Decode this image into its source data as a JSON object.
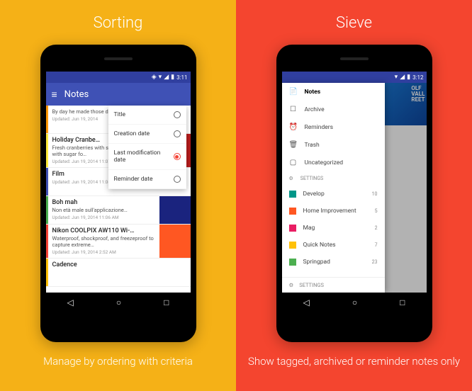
{
  "left": {
    "title": "Sorting",
    "caption": "Manage by ordering with criteria",
    "status_time": "3:11",
    "appbar_title": "Notes",
    "sort_options": [
      {
        "label": "Title",
        "selected": false
      },
      {
        "label": "Creation date",
        "selected": false
      },
      {
        "label": "Last modification date",
        "selected": true
      },
      {
        "label": "Reminder date",
        "selected": false
      }
    ],
    "notes": [
      {
        "stripe": "#ff9800",
        "title": "",
        "excerpt": "By day he made those dollars a minute. B…",
        "updated": "Updated: Jun 19, 2014",
        "thumb": false
      },
      {
        "stripe": "#ffeb3b",
        "title": "Holiday Cranbe…",
        "excerpt": "Fresh cranberries with spices and cooked with sugar fo…",
        "updated": "Updated: Jun 19, 2014 11:07 AM",
        "thumb": true,
        "thumb_bg": "#b71c1c"
      },
      {
        "stripe": "#3f51b5",
        "title": "Film",
        "excerpt": "",
        "updated": "Updated: Jun 19, 2014 11:06 AM",
        "thumb": false
      },
      {
        "stripe": "#4caf50",
        "title": "Boh mah",
        "excerpt": "Non età male sull'applicazione…",
        "updated": "Updated: Jun 19, 2014 11:06 AM",
        "thumb": true,
        "thumb_bg": "#1a237e"
      },
      {
        "stripe": "#f44336",
        "title": "Nikon COOLPIX AW110 Wi-…",
        "excerpt": "Waterproof, shockproof, and freezeproof to capture extreme…",
        "updated": "Updated: Jun 19, 2014 2:52 AM",
        "thumb": true,
        "thumb_bg": "#ff5722"
      },
      {
        "stripe": "#ffc107",
        "title": "Cadence",
        "excerpt": "",
        "updated": "",
        "thumb": false
      }
    ]
  },
  "right": {
    "title": "Sieve",
    "caption": "Show tagged, archived or reminder notes only",
    "status_time": "3:12",
    "bg_text": "OLF\nVALL\nREET",
    "drawer": {
      "main": [
        {
          "icon": "📄",
          "label": "Notes",
          "bold": true
        },
        {
          "icon": "☐",
          "label": "Archive"
        },
        {
          "icon": "⏰",
          "label": "Reminders"
        },
        {
          "icon": "🗑",
          "label": "Trash"
        },
        {
          "icon": "▢",
          "label": "Uncategorized"
        }
      ],
      "settings_header": "SETTINGS",
      "tags": [
        {
          "color": "#009688",
          "label": "Develop",
          "count": "10"
        },
        {
          "color": "#ff5722",
          "label": "Home Improvement",
          "count": "5"
        },
        {
          "color": "#e91e63",
          "label": "Mag",
          "count": "2"
        },
        {
          "color": "#ffc107",
          "label": "Quick Notes",
          "count": "7"
        },
        {
          "color": "#4caf50",
          "label": "Springpad",
          "count": "23"
        }
      ],
      "footer": "SETTINGS"
    }
  }
}
